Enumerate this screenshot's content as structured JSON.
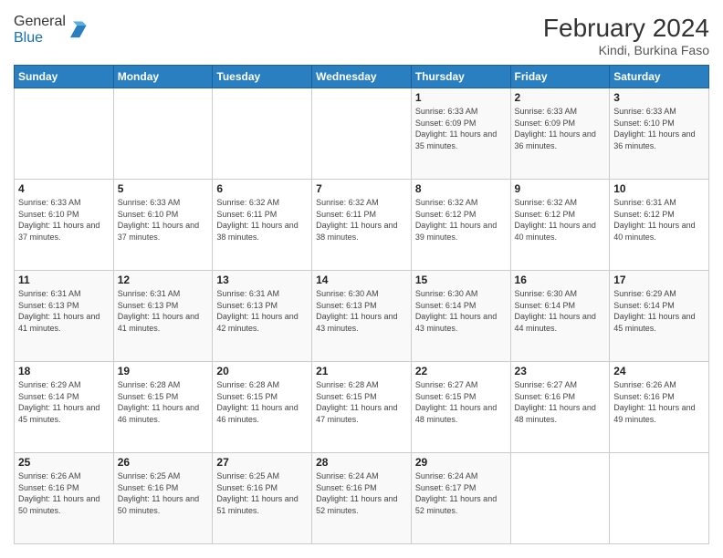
{
  "header": {
    "logo_general": "General",
    "logo_blue": "Blue",
    "month_year": "February 2024",
    "location": "Kindi, Burkina Faso"
  },
  "days_of_week": [
    "Sunday",
    "Monday",
    "Tuesday",
    "Wednesday",
    "Thursday",
    "Friday",
    "Saturday"
  ],
  "weeks": [
    [
      {
        "num": "",
        "info": ""
      },
      {
        "num": "",
        "info": ""
      },
      {
        "num": "",
        "info": ""
      },
      {
        "num": "",
        "info": ""
      },
      {
        "num": "1",
        "info": "Sunrise: 6:33 AM\nSunset: 6:09 PM\nDaylight: 11 hours and 35 minutes."
      },
      {
        "num": "2",
        "info": "Sunrise: 6:33 AM\nSunset: 6:09 PM\nDaylight: 11 hours and 36 minutes."
      },
      {
        "num": "3",
        "info": "Sunrise: 6:33 AM\nSunset: 6:10 PM\nDaylight: 11 hours and 36 minutes."
      }
    ],
    [
      {
        "num": "4",
        "info": "Sunrise: 6:33 AM\nSunset: 6:10 PM\nDaylight: 11 hours and 37 minutes."
      },
      {
        "num": "5",
        "info": "Sunrise: 6:33 AM\nSunset: 6:10 PM\nDaylight: 11 hours and 37 minutes."
      },
      {
        "num": "6",
        "info": "Sunrise: 6:32 AM\nSunset: 6:11 PM\nDaylight: 11 hours and 38 minutes."
      },
      {
        "num": "7",
        "info": "Sunrise: 6:32 AM\nSunset: 6:11 PM\nDaylight: 11 hours and 38 minutes."
      },
      {
        "num": "8",
        "info": "Sunrise: 6:32 AM\nSunset: 6:12 PM\nDaylight: 11 hours and 39 minutes."
      },
      {
        "num": "9",
        "info": "Sunrise: 6:32 AM\nSunset: 6:12 PM\nDaylight: 11 hours and 40 minutes."
      },
      {
        "num": "10",
        "info": "Sunrise: 6:31 AM\nSunset: 6:12 PM\nDaylight: 11 hours and 40 minutes."
      }
    ],
    [
      {
        "num": "11",
        "info": "Sunrise: 6:31 AM\nSunset: 6:13 PM\nDaylight: 11 hours and 41 minutes."
      },
      {
        "num": "12",
        "info": "Sunrise: 6:31 AM\nSunset: 6:13 PM\nDaylight: 11 hours and 41 minutes."
      },
      {
        "num": "13",
        "info": "Sunrise: 6:31 AM\nSunset: 6:13 PM\nDaylight: 11 hours and 42 minutes."
      },
      {
        "num": "14",
        "info": "Sunrise: 6:30 AM\nSunset: 6:13 PM\nDaylight: 11 hours and 43 minutes."
      },
      {
        "num": "15",
        "info": "Sunrise: 6:30 AM\nSunset: 6:14 PM\nDaylight: 11 hours and 43 minutes."
      },
      {
        "num": "16",
        "info": "Sunrise: 6:30 AM\nSunset: 6:14 PM\nDaylight: 11 hours and 44 minutes."
      },
      {
        "num": "17",
        "info": "Sunrise: 6:29 AM\nSunset: 6:14 PM\nDaylight: 11 hours and 45 minutes."
      }
    ],
    [
      {
        "num": "18",
        "info": "Sunrise: 6:29 AM\nSunset: 6:14 PM\nDaylight: 11 hours and 45 minutes."
      },
      {
        "num": "19",
        "info": "Sunrise: 6:28 AM\nSunset: 6:15 PM\nDaylight: 11 hours and 46 minutes."
      },
      {
        "num": "20",
        "info": "Sunrise: 6:28 AM\nSunset: 6:15 PM\nDaylight: 11 hours and 46 minutes."
      },
      {
        "num": "21",
        "info": "Sunrise: 6:28 AM\nSunset: 6:15 PM\nDaylight: 11 hours and 47 minutes."
      },
      {
        "num": "22",
        "info": "Sunrise: 6:27 AM\nSunset: 6:15 PM\nDaylight: 11 hours and 48 minutes."
      },
      {
        "num": "23",
        "info": "Sunrise: 6:27 AM\nSunset: 6:16 PM\nDaylight: 11 hours and 48 minutes."
      },
      {
        "num": "24",
        "info": "Sunrise: 6:26 AM\nSunset: 6:16 PM\nDaylight: 11 hours and 49 minutes."
      }
    ],
    [
      {
        "num": "25",
        "info": "Sunrise: 6:26 AM\nSunset: 6:16 PM\nDaylight: 11 hours and 50 minutes."
      },
      {
        "num": "26",
        "info": "Sunrise: 6:25 AM\nSunset: 6:16 PM\nDaylight: 11 hours and 50 minutes."
      },
      {
        "num": "27",
        "info": "Sunrise: 6:25 AM\nSunset: 6:16 PM\nDaylight: 11 hours and 51 minutes."
      },
      {
        "num": "28",
        "info": "Sunrise: 6:24 AM\nSunset: 6:16 PM\nDaylight: 11 hours and 52 minutes."
      },
      {
        "num": "29",
        "info": "Sunrise: 6:24 AM\nSunset: 6:17 PM\nDaylight: 11 hours and 52 minutes."
      },
      {
        "num": "",
        "info": ""
      },
      {
        "num": "",
        "info": ""
      }
    ]
  ]
}
